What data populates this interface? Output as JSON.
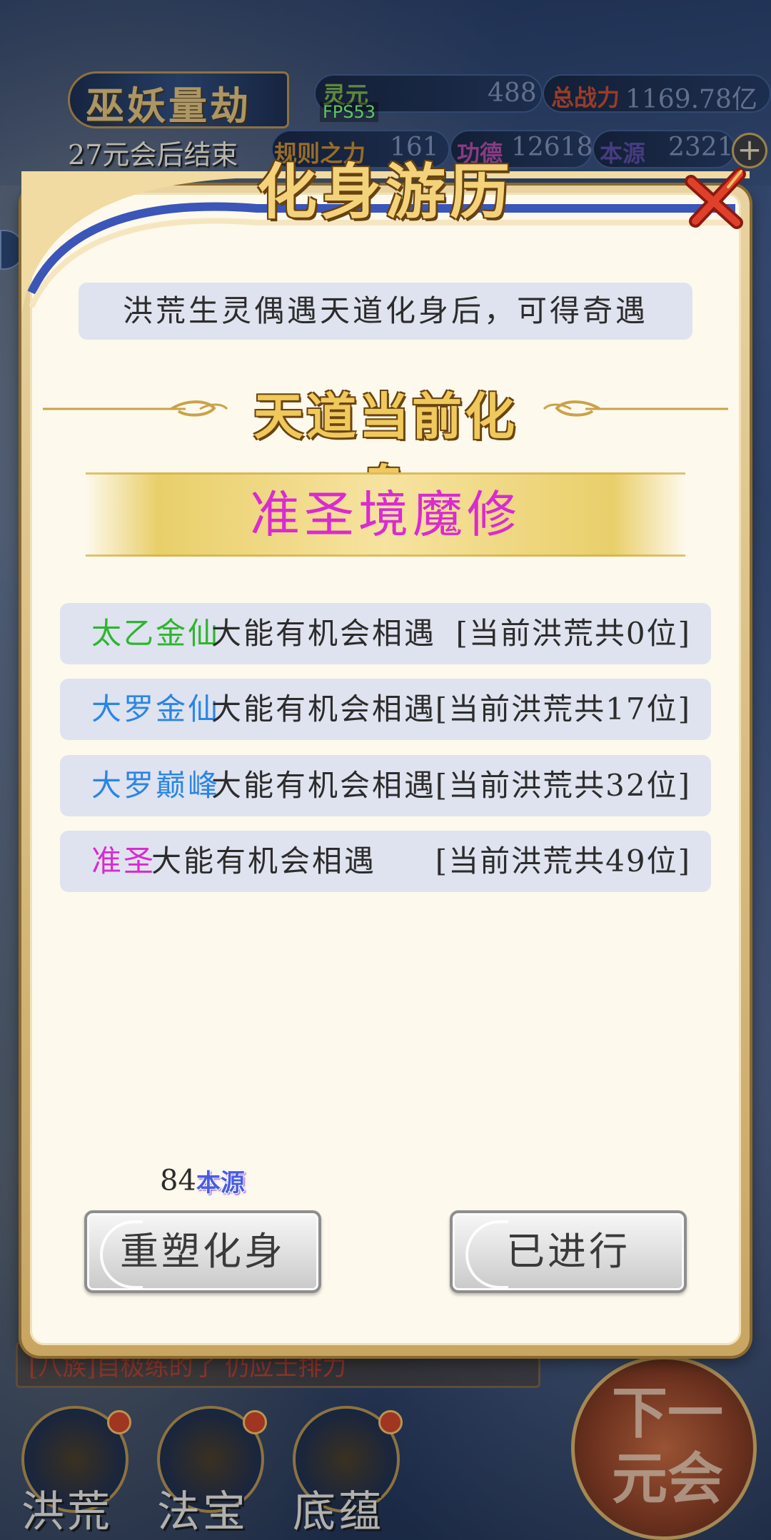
{
  "hud": {
    "title": "巫妖量劫",
    "end_text": "27元会后结束",
    "fps": "FPS53",
    "resources": {
      "lingyuan_label": "灵元",
      "lingyuan_value": "488",
      "power_label": "总战力",
      "power_value": "1169.78亿",
      "law_label": "规则之力",
      "law_value": "161",
      "merit_label": "功德",
      "merit_value": "12618",
      "origin_label": "本源",
      "origin_value": "2321"
    },
    "plus_icon": "plus-icon",
    "scroll_text": "[八族]自极练的了 仍应士排力"
  },
  "bottom_nav": {
    "items": [
      {
        "label": "洪荒",
        "icon": "dragon-icon"
      },
      {
        "label": "法宝",
        "icon": "treasure-icon"
      },
      {
        "label": "底蕴",
        "icon": "lotus-icon"
      }
    ],
    "next_label": "下一元会"
  },
  "dialog": {
    "title": "化身游历",
    "close_icon": "close-x-icon",
    "intro": "洪荒生灵偶遇天道化身后，可得奇遇",
    "section_title": "天道当前化身",
    "current_avatar": "准圣境魔修",
    "realms": [
      {
        "name": "太乙金仙",
        "color": "#2fb52f",
        "desc": "大能有机会相遇",
        "count": "[当前洪荒共0位]"
      },
      {
        "name": "大罗金仙",
        "color": "#2a86e6",
        "desc": "大能有机会相遇",
        "count": "[当前洪荒共17位]"
      },
      {
        "name": "大罗巅峰",
        "color": "#2a86e6",
        "desc": "大能有机会相遇",
        "count": "[当前洪荒共32位]"
      },
      {
        "name": "准圣",
        "color": "#d92bd0",
        "desc": "大能有机会相遇",
        "count": "[当前洪荒共49位]"
      }
    ],
    "cost_value": "84",
    "cost_unit": "本源",
    "reshape_button": "重塑化身",
    "done_button": "已进行"
  },
  "colors": {
    "dialog_bg": "#fdf9ec",
    "gold": "#f0c95c",
    "row_bg": "#dfe3ef",
    "avatar_color": "#d92bd0"
  }
}
